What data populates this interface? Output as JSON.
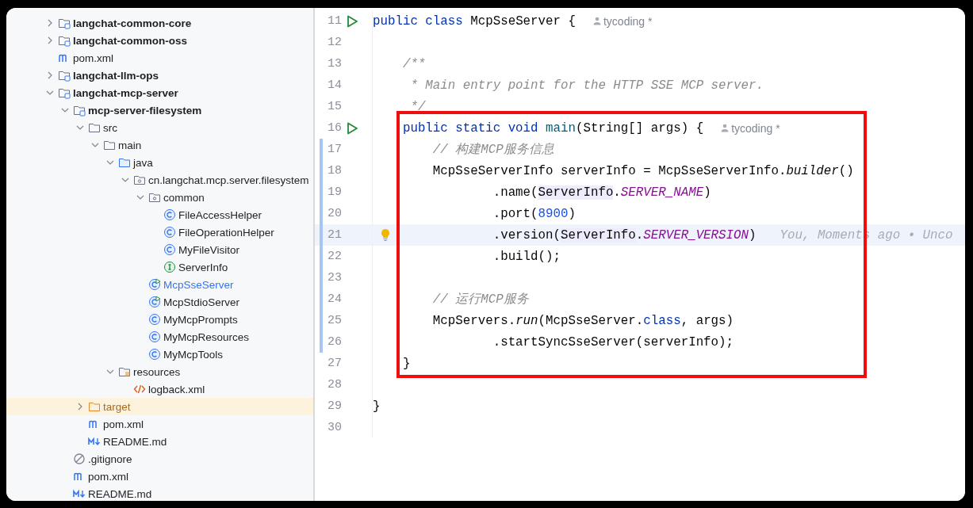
{
  "project_tree": {
    "items": [
      {
        "children": [
          {
            "label": "langchat-common-core",
            "kind": "module",
            "expanded": false,
            "selected": false,
            "modified": false
          },
          {
            "label": "langchat-common-oss",
            "kind": "module",
            "expanded": false,
            "selected": false,
            "modified": false
          },
          {
            "label": "pom.xml",
            "kind": "maven",
            "selected": false,
            "modified": false
          }
        ]
      },
      {
        "label": "langchat-llm-ops",
        "kind": "module",
        "expanded": false,
        "selected": false,
        "modified": false
      },
      {
        "label": "langchat-mcp-server",
        "kind": "module",
        "expanded": true,
        "selected": false,
        "modified": false,
        "children": [
          {
            "label": "mcp-server-filesystem",
            "kind": "module",
            "expanded": true,
            "selected": false,
            "modified": false,
            "children": [
              {
                "label": "src",
                "kind": "folder",
                "expanded": true,
                "selected": false,
                "modified": false,
                "children": [
                  {
                    "label": "main",
                    "kind": "folder",
                    "expanded": true,
                    "selected": false,
                    "modified": false,
                    "children": [
                      {
                        "label": "java",
                        "kind": "source-folder",
                        "expanded": true,
                        "selected": false,
                        "modified": false,
                        "children": [
                          {
                            "label": "cn.langchat.mcp.server.filesystem",
                            "kind": "package",
                            "expanded": true,
                            "selected": false,
                            "modified": false,
                            "children": [
                              {
                                "label": "common",
                                "kind": "package",
                                "expanded": true,
                                "selected": false,
                                "modified": false,
                                "children": [
                                  {
                                    "label": "FileAccessHelper",
                                    "kind": "class",
                                    "selected": false,
                                    "modified": false
                                  },
                                  {
                                    "label": "FileOperationHelper",
                                    "kind": "class",
                                    "selected": false,
                                    "modified": false
                                  },
                                  {
                                    "label": "MyFileVisitor",
                                    "kind": "class",
                                    "selected": false,
                                    "modified": false
                                  },
                                  {
                                    "label": "ServerInfo",
                                    "kind": "interface",
                                    "selected": false,
                                    "modified": false
                                  }
                                ]
                              },
                              {
                                "label": "McpSseServer",
                                "kind": "runnable-class",
                                "selected": false,
                                "modified": true
                              },
                              {
                                "label": "McpStdioServer",
                                "kind": "runnable-class",
                                "selected": false,
                                "modified": false
                              },
                              {
                                "label": "MyMcpPrompts",
                                "kind": "class",
                                "selected": false,
                                "modified": false
                              },
                              {
                                "label": "MyMcpResources",
                                "kind": "class",
                                "selected": false,
                                "modified": false
                              },
                              {
                                "label": "MyMcpTools",
                                "kind": "class",
                                "selected": false,
                                "modified": false
                              }
                            ]
                          }
                        ]
                      },
                      {
                        "label": "resources",
                        "kind": "resources-folder",
                        "expanded": true,
                        "selected": false,
                        "modified": false,
                        "children": [
                          {
                            "label": "logback.xml",
                            "kind": "xml",
                            "selected": false,
                            "modified": false
                          }
                        ]
                      }
                    ]
                  }
                ]
              },
              {
                "label": "target",
                "kind": "excluded-folder",
                "expanded": false,
                "selected": true,
                "modified": false
              },
              {
                "label": "pom.xml",
                "kind": "maven",
                "selected": false,
                "modified": false
              },
              {
                "label": "README.md",
                "kind": "markdown",
                "selected": false,
                "modified": false
              }
            ]
          },
          {
            "label": ".gitignore",
            "kind": "gitignore",
            "selected": false,
            "modified": false
          },
          {
            "label": "pom.xml",
            "kind": "maven",
            "selected": false,
            "modified": false
          },
          {
            "label": "README.md",
            "kind": "markdown",
            "selected": false,
            "modified": false
          }
        ]
      }
    ]
  },
  "editor": {
    "lines": [
      {
        "number": "11",
        "run": true,
        "changed": false,
        "current": false,
        "intention": false,
        "boxed": false,
        "tokens": [
          {
            "kind": "keyword",
            "text": "public class "
          },
          {
            "kind": "plain",
            "text": "McpSseServer {"
          }
        ],
        "author": "tycoding *"
      },
      {
        "number": "12",
        "run": false,
        "changed": false,
        "current": false,
        "intention": false,
        "boxed": false
      },
      {
        "number": "13",
        "run": false,
        "changed": false,
        "current": false,
        "intention": false,
        "boxed": false,
        "tokens": [
          {
            "kind": "doc",
            "text": "    /**"
          }
        ]
      },
      {
        "number": "14",
        "run": false,
        "changed": false,
        "current": false,
        "intention": false,
        "boxed": false,
        "tokens": [
          {
            "kind": "doc",
            "text": "     * Main entry point for the HTTP SSE MCP server."
          }
        ]
      },
      {
        "number": "15",
        "run": false,
        "changed": false,
        "current": false,
        "intention": false,
        "boxed": false,
        "tokens": [
          {
            "kind": "doc",
            "text": "     */"
          }
        ]
      },
      {
        "number": "16",
        "run": true,
        "changed": false,
        "current": false,
        "intention": false,
        "boxed": true,
        "tokens": [
          {
            "kind": "keyword",
            "text": "    public static void "
          },
          {
            "kind": "method",
            "text": "main"
          },
          {
            "kind": "plain",
            "text": "(String[] args) {"
          }
        ],
        "author": "tycoding *"
      },
      {
        "number": "17",
        "run": false,
        "changed": true,
        "current": false,
        "intention": false,
        "boxed": true,
        "tokens": [
          {
            "kind": "comment",
            "text": "        // 构建MCP服务信息"
          }
        ]
      },
      {
        "number": "18",
        "run": false,
        "changed": true,
        "current": false,
        "intention": false,
        "boxed": true,
        "tokens": [
          {
            "kind": "plain",
            "text": "        McpSseServerInfo serverInfo = McpSseServerInfo."
          },
          {
            "kind": "static-call",
            "text": "builder"
          },
          {
            "kind": "plain",
            "text": "()"
          }
        ]
      },
      {
        "number": "19",
        "run": false,
        "changed": true,
        "current": false,
        "intention": false,
        "boxed": true,
        "tokens": [
          {
            "kind": "plain",
            "text": "                .name("
          },
          {
            "kind": "usage",
            "text": "ServerInfo"
          },
          {
            "kind": "plain",
            "text": "."
          },
          {
            "kind": "constant",
            "text": "SERVER_NAME"
          },
          {
            "kind": "plain",
            "text": ")"
          }
        ]
      },
      {
        "number": "20",
        "run": false,
        "changed": true,
        "current": false,
        "intention": false,
        "boxed": true,
        "tokens": [
          {
            "kind": "plain",
            "text": "                .port("
          },
          {
            "kind": "number",
            "text": "8900"
          },
          {
            "kind": "plain",
            "text": ")"
          }
        ]
      },
      {
        "number": "21",
        "run": false,
        "changed": true,
        "current": true,
        "intention": true,
        "boxed": true,
        "tokens": [
          {
            "kind": "plain",
            "text": "                .version("
          },
          {
            "kind": "usage",
            "text": "ServerInfo"
          },
          {
            "kind": "plain",
            "text": "."
          },
          {
            "kind": "constant",
            "text": "SERVER_VERSION"
          },
          {
            "kind": "plain",
            "text": ")"
          }
        ],
        "blame": "You, Moments ago • Unco"
      },
      {
        "number": "22",
        "run": false,
        "changed": true,
        "current": false,
        "intention": false,
        "boxed": true,
        "tokens": [
          {
            "kind": "plain",
            "text": "                .build();"
          }
        ]
      },
      {
        "number": "23",
        "run": false,
        "changed": true,
        "current": false,
        "intention": false,
        "boxed": true
      },
      {
        "number": "24",
        "run": false,
        "changed": true,
        "current": false,
        "intention": false,
        "boxed": true,
        "tokens": [
          {
            "kind": "comment",
            "text": "        // 运行MCP服务"
          }
        ]
      },
      {
        "number": "25",
        "run": false,
        "changed": true,
        "current": false,
        "intention": false,
        "boxed": true,
        "tokens": [
          {
            "kind": "plain",
            "text": "        McpServers."
          },
          {
            "kind": "static-call",
            "text": "run"
          },
          {
            "kind": "plain",
            "text": "(McpSseServer."
          },
          {
            "kind": "keyword",
            "text": "class"
          },
          {
            "kind": "plain",
            "text": ", args)"
          }
        ]
      },
      {
        "number": "26",
        "run": false,
        "changed": true,
        "current": false,
        "intention": false,
        "boxed": true,
        "tokens": [
          {
            "kind": "plain",
            "text": "                .startSyncSseServer(serverInfo);"
          }
        ]
      },
      {
        "number": "27",
        "run": false,
        "changed": false,
        "current": false,
        "intention": false,
        "boxed": true,
        "tokens": [
          {
            "kind": "plain",
            "text": "    }"
          }
        ]
      },
      {
        "number": "28",
        "run": false,
        "changed": false,
        "current": false,
        "intention": false,
        "boxed": false
      },
      {
        "number": "29",
        "run": false,
        "changed": false,
        "current": false,
        "intention": false,
        "boxed": false,
        "tokens": [
          {
            "kind": "plain",
            "text": "}"
          }
        ]
      },
      {
        "number": "30",
        "run": false,
        "changed": false,
        "current": false,
        "intention": false,
        "boxed": false
      }
    ]
  }
}
